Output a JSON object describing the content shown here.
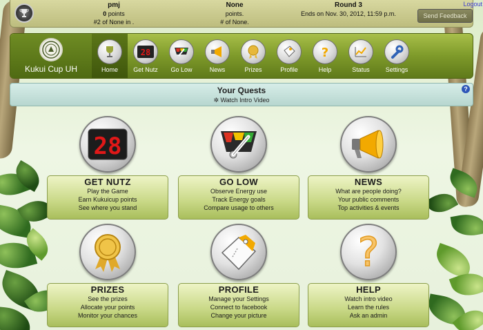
{
  "status_bar": {
    "user": {
      "name": "pmj",
      "points_value": "0",
      "points_suffix": " points",
      "rank": "#2 of None in ."
    },
    "team": {
      "name": "None",
      "points": "points.",
      "rank": "# of None."
    },
    "round": {
      "name": "Round 3",
      "ends": "Ends on Nov. 30, 2012, 11:59 p.m."
    },
    "logout_label": "Logout",
    "feedback_label": "Send Feedback"
  },
  "brand": {
    "name": "Kukui Cup UH"
  },
  "nav": {
    "items": [
      {
        "label": "Home",
        "icon": "trophy-icon"
      },
      {
        "label": "Get Nutz",
        "icon": "scoreboard-icon"
      },
      {
        "label": "Go Low",
        "icon": "gauge-icon"
      },
      {
        "label": "News",
        "icon": "megaphone-icon"
      },
      {
        "label": "Prizes",
        "icon": "medal-icon"
      },
      {
        "label": "Profile",
        "icon": "tag-icon"
      },
      {
        "label": "Help",
        "icon": "question-icon"
      },
      {
        "label": "Status",
        "icon": "chart-icon"
      },
      {
        "label": "Settings",
        "icon": "wrench-icon"
      }
    ],
    "active": "Home"
  },
  "quests": {
    "title": "Your Quests",
    "video_label": "Watch Intro Video",
    "help_label": "?"
  },
  "tiles": {
    "get_nutz": {
      "title": "GET NUTZ",
      "lines": [
        "Play the Game",
        "Earn Kukuicup points",
        "See where you stand"
      ],
      "display": "28"
    },
    "go_low": {
      "title": "GO LOW",
      "lines": [
        "Observe Energy use",
        "Track Energy goals",
        "Compare usage to others"
      ]
    },
    "news": {
      "title": "NEWS",
      "lines": [
        "What are people doing?",
        "Your public comments",
        "Top activities & events"
      ]
    },
    "prizes": {
      "title": "PRIZES",
      "lines": [
        "See the prizes",
        "Allocate your points",
        "Monitor your chances"
      ]
    },
    "profile": {
      "title": "PROFILE",
      "lines": [
        "Manage your Settings",
        "Connect to facebook",
        "Change your picture"
      ]
    },
    "help": {
      "title": "HELP",
      "lines": [
        "Watch intro video",
        "Learn the rules",
        "Ask an admin"
      ]
    }
  },
  "colors": {
    "nav_green": "#7e9a2a",
    "card_green": "#c8d886",
    "quests_teal": "#b7d6cf",
    "accent_orange": "#f2a900",
    "scoreboard_red": "#e01818"
  }
}
